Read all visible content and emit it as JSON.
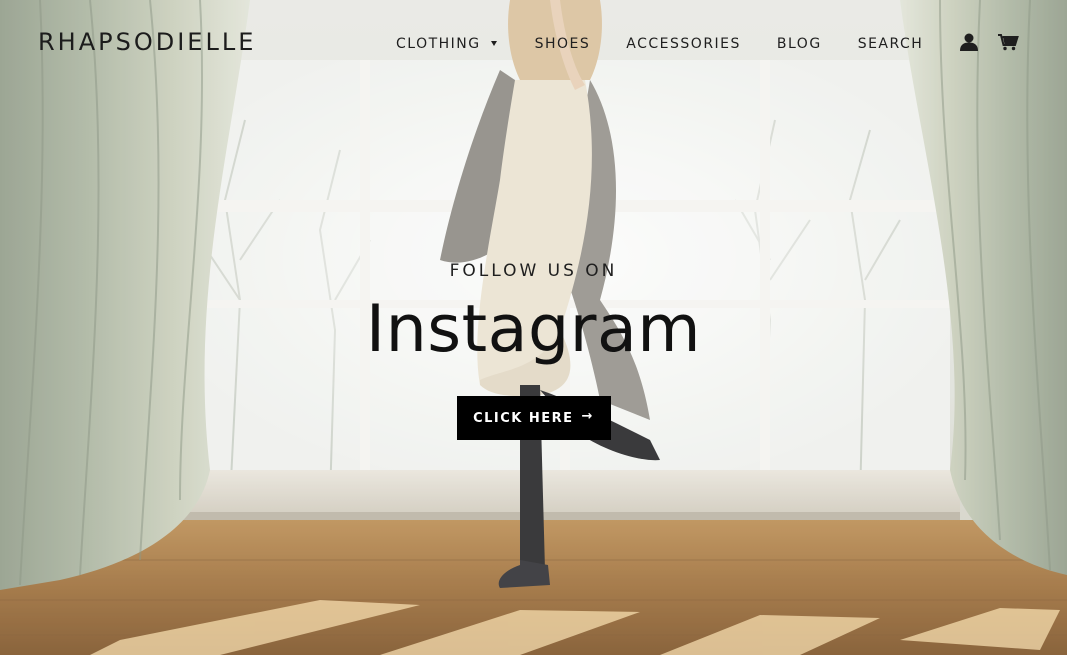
{
  "header": {
    "logo": "RHAPSODIELLE",
    "nav": [
      {
        "label": "CLOTHING",
        "has_dropdown": true
      },
      {
        "label": "SHOES"
      },
      {
        "label": "ACCESSORIES"
      },
      {
        "label": "BLOG"
      },
      {
        "label": "SEARCH"
      }
    ],
    "account_icon": "user-icon",
    "cart_icon": "cart-icon"
  },
  "hero": {
    "eyebrow": "FOLLOW US ON",
    "title": "Instagram",
    "button_label": "CLICK HERE",
    "button_arrow": "→",
    "image": "woman-by-window-photo"
  },
  "colors": {
    "text": "#1f1f1f",
    "button_bg": "#000000",
    "button_text": "#ffffff"
  }
}
